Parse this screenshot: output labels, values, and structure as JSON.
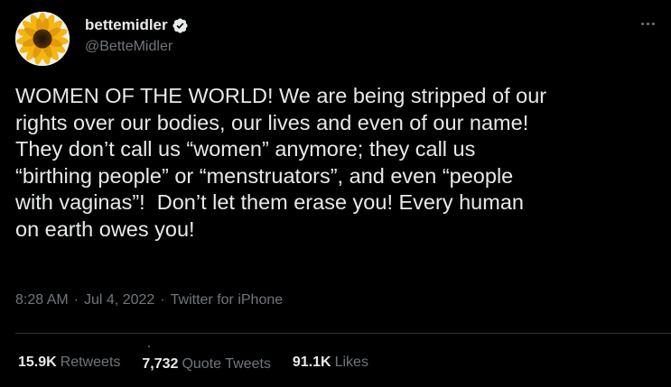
{
  "author": {
    "display_name": "bettemidler",
    "handle": "@BetteMidler",
    "verified": true,
    "avatar": "sunflower-avatar"
  },
  "tweet": {
    "lines": [
      "WOMEN OF THE WORLD! We are being stripped of our",
      "rights over our bodies, our lives and even of our name!",
      "They don’t call us “women” anymore; they call us",
      "“birthing people” or “menstruators”, and even “people",
      "with vaginas”!  Don’t let them erase you! Every human",
      "on earth owes you!"
    ]
  },
  "meta": {
    "time": "8:28 AM",
    "separator": "·",
    "date": "Jul 4, 2022",
    "source": "Twitter for iPhone"
  },
  "stats": {
    "retweets_count": "15.9K",
    "retweets_label": "Retweets",
    "quotes_count": "7,732",
    "quotes_label": "Quote Tweets",
    "likes_count": "91.1K",
    "likes_label": "Likes"
  },
  "colors": {
    "background": "#000000",
    "text": "#e7e9ea",
    "secondary": "#71767b",
    "verified": "#e7e9ea"
  },
  "icons": {
    "more": "more-options-icon",
    "verified": "verified-badge-icon"
  }
}
